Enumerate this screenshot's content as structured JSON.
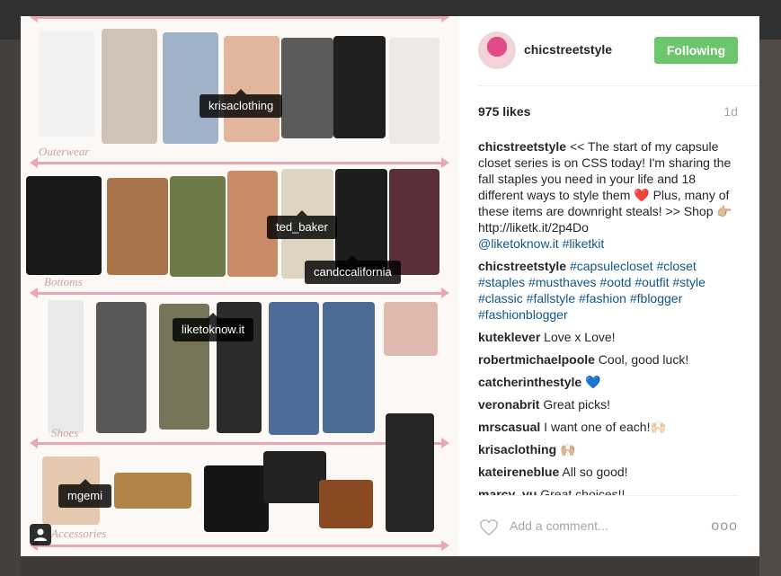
{
  "photo": {
    "sections": [
      "Outerwear",
      "Bottoms",
      "Shoes",
      "Accessories"
    ],
    "tags": [
      "krisaclothing",
      "ted_baker",
      "candccalifornia",
      "liketoknow.it",
      "mgemi"
    ]
  },
  "post": {
    "username": "chicstreetstyle",
    "follow_label": "Following",
    "likes": "975 likes",
    "time": "1d",
    "caption": {
      "user": "chicstreetstyle",
      "text_1": " << The start of my capsule closet series is on CSS today! I'm sharing the fall staples you need in your life and 18 different ways to style them ",
      "emoji_1": "❤️",
      "text_2": " Plus, many of these items are downright steals! >> Shop ",
      "emoji_2": "👉🏼",
      "text_3": " http://liketk.it/2p4Do",
      "mentions": "@liketoknow.it #liketkit"
    },
    "hashtag_comment": {
      "user": "chicstreetstyle",
      "text": " #capsulecloset #closet #staples #musthaves #ootd #outfit #style #classic #fallstyle #fashion #fblogger #fashionblogger"
    },
    "comments": [
      {
        "user": "kuteklever",
        "text": " Love x Love!"
      },
      {
        "user": "robertmichaelpoole",
        "text": " Cool, good luck!"
      },
      {
        "user": "catcherinthestyle",
        "text": " 💙"
      },
      {
        "user": "veronabrit",
        "text": " Great picks!"
      },
      {
        "user": "mrscasual",
        "text": " I want one of each!🙌🏻"
      },
      {
        "user": "krisaclothing",
        "text": " 🙌🏼"
      },
      {
        "user": "kateireneblue",
        "text": " All so good!"
      },
      {
        "user": "marcy_vu",
        "text": " Great choices!!"
      }
    ],
    "add_comment_placeholder": "Add a comment...",
    "more_label": "ooo"
  },
  "colors": {
    "following_green": "#6cc66c",
    "link_blue": "#125688",
    "muted_gray": "#a5a7aa"
  },
  "icons": [
    "user-tag-icon",
    "heart-icon",
    "more-options-icon"
  ]
}
